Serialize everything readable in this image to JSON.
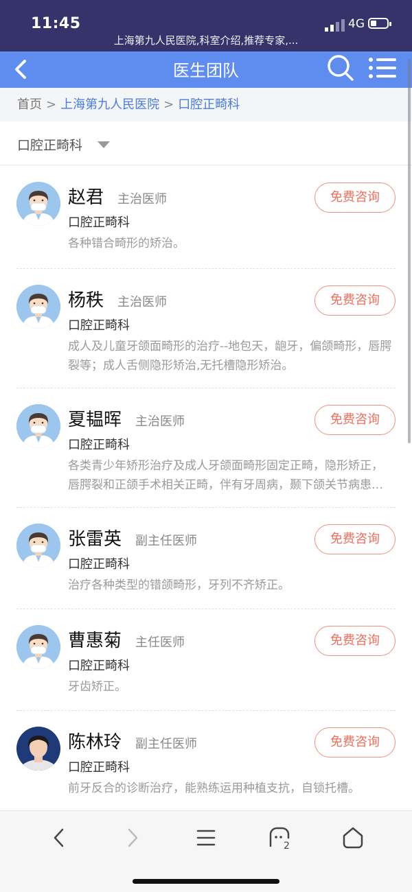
{
  "status_bar": {
    "time": "11:45",
    "network": "4G",
    "page_url_title": "上海第九人民医院,科室介绍,推荐专家,..."
  },
  "nav": {
    "title": "医生团队",
    "back_icon": "chevron-left-icon",
    "search_icon": "search-icon",
    "menu_icon": "list-menu-icon"
  },
  "breadcrumb": {
    "home": "首页",
    "separator": ">",
    "hospital": "上海第九人民医院",
    "department": "口腔正畸科"
  },
  "filter": {
    "label": "口腔正畸科"
  },
  "doctors": [
    {
      "name": "赵君",
      "title": "主治医师",
      "dept": "口腔正畸科",
      "desc": "各种错合畸形的矫治。",
      "button": "免费咨询"
    },
    {
      "name": "杨秩",
      "title": "主治医师",
      "dept": "口腔正畸科",
      "desc": "成人及儿童牙颌面畸形的治疗--地包天，龅牙，偏颌畸形，唇腭裂等；成人舌侧隐形矫治,无托槽隐形矫治。",
      "button": "免费咨询"
    },
    {
      "name": "夏韫晖",
      "title": "主治医师",
      "dept": "口腔正畸科",
      "desc": "各类青少年矫形治疗及成人牙颌面畸形固定正畸，隐形矫正，唇腭裂和正颌手术相关正畸，伴有牙周病，颞下颌关节病患者的正畸治疗。",
      "button": "免费咨询"
    },
    {
      "name": "张雷英",
      "title": "副主任医师",
      "dept": "口腔正畸科",
      "desc": "治疗各种类型的错颌畸形，牙列不齐矫正。",
      "button": "免费咨询"
    },
    {
      "name": "曹惠菊",
      "title": "主任医师",
      "dept": "口腔正畸科",
      "desc": "牙齿矫正。",
      "button": "免费咨询"
    },
    {
      "name": "陈林玲",
      "title": "副主任医师",
      "dept": "口腔正畸科",
      "desc": "前牙反合的诊断治疗，能熟练运用种植支抗，自锁托槽。",
      "button": "免费咨询"
    }
  ],
  "bottom_bar": {
    "icons": [
      "back-icon",
      "forward-icon",
      "menu-icon",
      "tabs-icon",
      "home-icon"
    ],
    "tabs_count": "2"
  },
  "colors": {
    "nav_bg": "#5f8def",
    "status_bg": "#35336a",
    "consult_accent": "#ee6f5a",
    "link": "#4a7be0"
  }
}
